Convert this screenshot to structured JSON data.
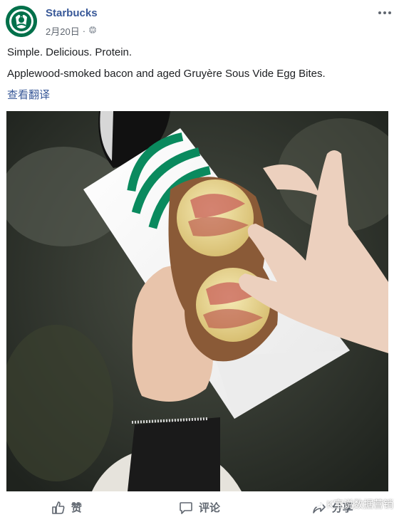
{
  "post": {
    "author": "Starbucks",
    "date": "2月20日",
    "lines": [
      "Simple. Delicious. Protein.",
      "Applewood-smoked bacon and aged Gruyère Sous Vide Egg Bites."
    ],
    "translate_label": "查看翻译",
    "privacy_icon": "globe-icon",
    "menu_icon": "more-icon"
  },
  "actions": {
    "like_label": "赞",
    "comment_label": "评论",
    "share_label": "分享"
  },
  "watermark": "K宝说数据营销",
  "colors": {
    "brand": "#00704a",
    "link": "#385898",
    "secondary_text": "#606770"
  }
}
